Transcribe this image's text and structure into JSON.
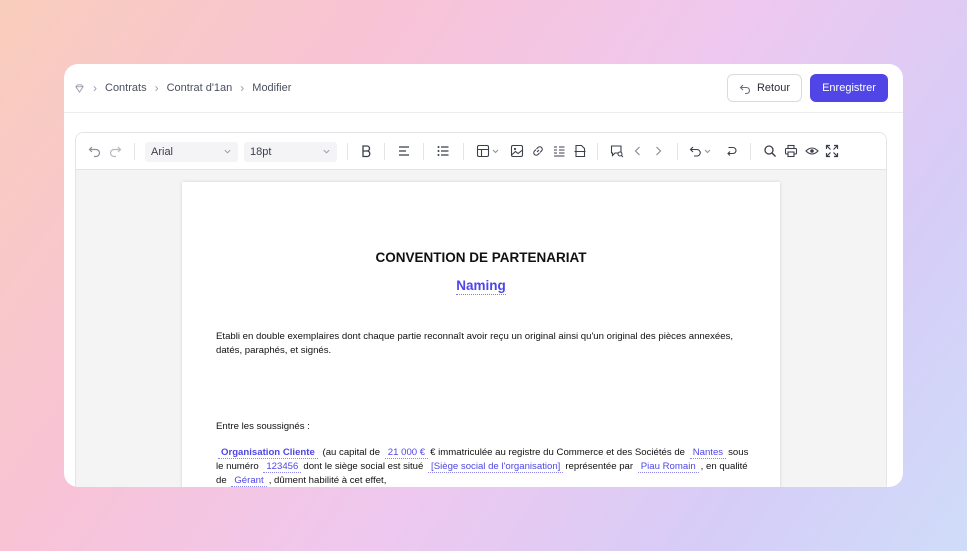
{
  "breadcrumb": {
    "items": [
      "Contrats",
      "Contrat d'1an",
      "Modifier"
    ]
  },
  "actions": {
    "back_label": "Retour",
    "save_label": "Enregistrer"
  },
  "toolbar": {
    "font_family": "Arial",
    "font_size": "18pt",
    "icons": [
      "undo-icon",
      "redo-icon",
      "bold-icon",
      "align-left-icon",
      "bullet-list-icon",
      "table-icon",
      "image-icon",
      "link-icon",
      "list-icon",
      "document-icon",
      "comment-icon",
      "chevron-left-icon",
      "chevron-right-icon",
      "track-changes-icon",
      "revert-icon",
      "search-icon",
      "print-icon",
      "preview-icon",
      "fullscreen-icon"
    ]
  },
  "document": {
    "title": "CONVENTION DE PARTENARIAT",
    "subtitle_field": "Naming",
    "intro_line1": "Etabli en double exemplaires dont chaque partie reconnaît avoir reçu un original ainsi qu'un original des pièces annexées,",
    "intro_line2": "datés, paraphés, et signés.",
    "parties_heading": "Entre les soussignés :",
    "clause": {
      "org_name": "Organisation Cliente",
      "t1": "(au capital de",
      "capital": "21 000 €",
      "t2": "€ immatriculée au registre du Commerce et des Sociétés de",
      "city": "Nantes",
      "t3": "sous",
      "t4": "le numéro",
      "number": "123456",
      "t5": "dont le siège social est situé",
      "address": "[Siège social de l'organisation]",
      "t6": "représentée par",
      "representative": "Piau Romain",
      "t7": ", en qualité",
      "t8": "de",
      "role": "Gérant",
      "t9": ", dûment habilité à cet effet,"
    }
  },
  "colors": {
    "accent": "#4f46e5",
    "card_bg": "#ffffff",
    "editor_bg": "#f4f4f5"
  }
}
